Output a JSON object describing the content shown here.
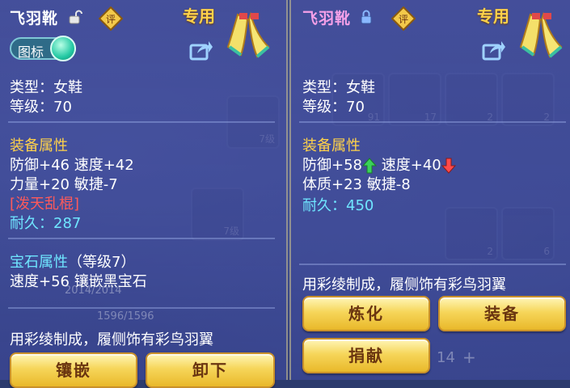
{
  "left": {
    "title": "飞羽靴",
    "exclusive": "专用",
    "toggle_label": "图标",
    "type_line": "类型：女鞋",
    "level_line": "等级：70",
    "attr_header": "装备属性",
    "attr_line1": "防御+46 速度+42",
    "attr_line2": "力量+20 敏捷-7",
    "special": "[泼天乱棍]",
    "durability_label": "耐久：",
    "durability_value": "287",
    "gem_header": "宝石属性",
    "gem_level": "（等级7）",
    "gem_line": "速度+56 镶嵌黑宝石",
    "desc": "用彩绫制成，履侧饰有彩鸟羽翼",
    "btn_inlay": "镶嵌",
    "btn_unload": "卸下"
  },
  "right": {
    "title": "飞羽靴",
    "exclusive": "专用",
    "type_line": "类型：女鞋",
    "level_line": "等级：70",
    "attr_header": "装备属性",
    "attr_def": "防御+58",
    "attr_speed": "速度+40",
    "attr_line2": "体质+23 敏捷-8",
    "durability_label": "耐久：",
    "durability_value": "450",
    "desc": "用彩绫制成，履侧饰有彩鸟羽翼",
    "btn_refine": "炼化",
    "btn_equip": "装备",
    "btn_donate": "捐献"
  },
  "background": {
    "slot_levels": [
      "7级",
      "7级",
      "7级",
      "4级"
    ],
    "counts": [
      "91",
      "17",
      "2",
      "2",
      "2",
      "6"
    ],
    "hp_bar": "2014/2014",
    "mp_bar": "1596/1596",
    "stepper_value": "14"
  },
  "colors": {
    "gold": "#ffd24a",
    "cyan": "#6fe6ff",
    "red": "#ff5a5a",
    "pink_title": "#f5a0e8"
  }
}
